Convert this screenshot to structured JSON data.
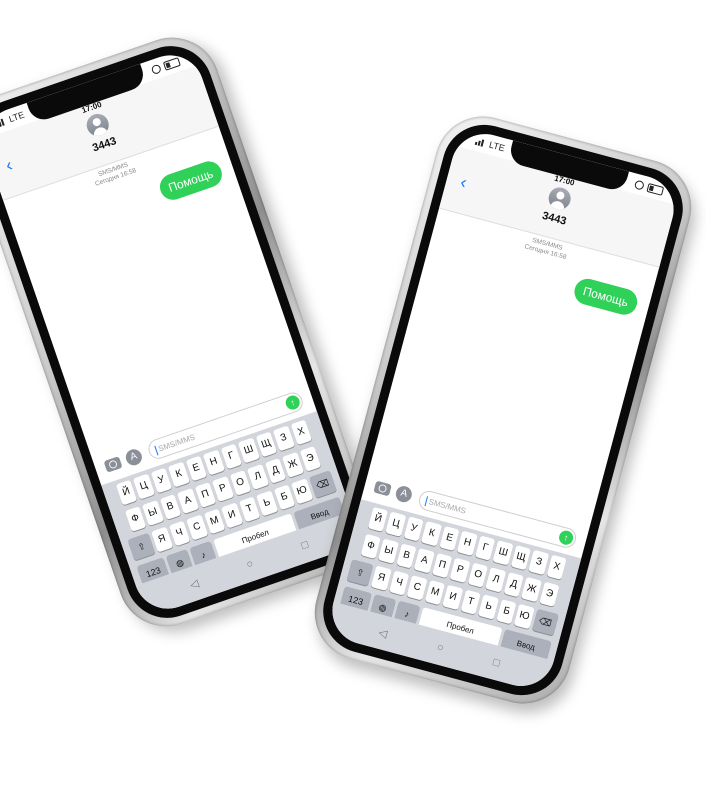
{
  "phones": [
    {
      "status": {
        "network": "LTE",
        "time": "17:00"
      },
      "contact": "3443",
      "meta": {
        "channel": "SMS/MMS",
        "date": "Сегодня 16:58"
      },
      "message": "Помощь",
      "compose_placeholder": "SMS/MMS",
      "keyboard": {
        "row1": [
          "Й",
          "Ц",
          "У",
          "К",
          "Е",
          "Н",
          "Г",
          "Ш",
          "Щ",
          "З",
          "Х"
        ],
        "row2": [
          "Ф",
          "Ы",
          "В",
          "А",
          "П",
          "Р",
          "О",
          "Л",
          "Д",
          "Ж",
          "Э"
        ],
        "row3": [
          "Я",
          "Ч",
          "С",
          "М",
          "И",
          "Т",
          "Ь",
          "Б",
          "Ю"
        ],
        "num_label": "123",
        "space_label": "Пробел",
        "enter_label": "Ввод"
      }
    },
    {
      "status": {
        "network": "LTE",
        "time": "17:00"
      },
      "contact": "3443",
      "meta": {
        "channel": "SMS/MMS",
        "date": "Сегодня 16:58"
      },
      "message": "Помощь",
      "compose_placeholder": "SMS/MMS",
      "keyboard": {
        "row1": [
          "Й",
          "Ц",
          "У",
          "К",
          "Е",
          "Н",
          "Г",
          "Ш",
          "Щ",
          "З",
          "Х"
        ],
        "row2": [
          "Ф",
          "Ы",
          "В",
          "А",
          "П",
          "Р",
          "О",
          "Л",
          "Д",
          "Ж",
          "Э"
        ],
        "row3": [
          "Я",
          "Ч",
          "С",
          "М",
          "И",
          "Т",
          "Ь",
          "Б",
          "Ю"
        ],
        "num_label": "123",
        "space_label": "Пробел",
        "enter_label": "Ввод"
      }
    }
  ],
  "icons": {
    "back": "chevron-left-icon",
    "send": "arrow-up-icon",
    "camera": "camera-icon",
    "appstore": "appstore-icon",
    "shift": "shift-icon",
    "backspace": "backspace-icon",
    "globe": "globe-icon",
    "mic": "microphone-icon"
  },
  "colors": {
    "bubble": "#2fd158",
    "accent": "#1a7cf5",
    "keyboard_bg": "#d2d5db"
  }
}
